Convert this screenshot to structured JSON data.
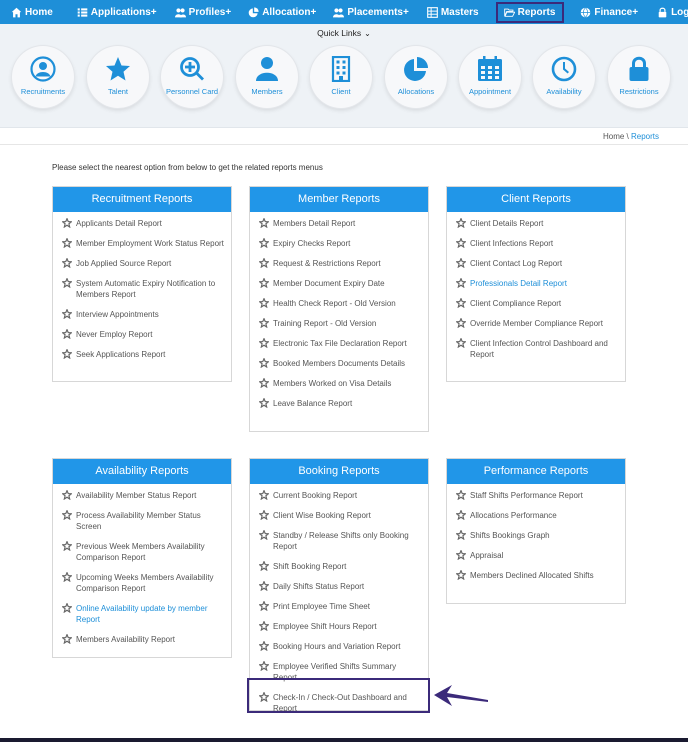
{
  "nav": {
    "home": "Home",
    "applications": "Applications+",
    "profiles": "Profiles+",
    "allocation": "Allocation+",
    "placements": "Placements+",
    "masters": "Masters",
    "reports": "Reports",
    "finance": "Finance+",
    "logins": "Logins+"
  },
  "quick_links": {
    "title": "Quick Links",
    "items": [
      {
        "label": "Recruitments",
        "icon": "user-circle-icon"
      },
      {
        "label": "Talent",
        "icon": "star-icon"
      },
      {
        "label": "Personnel Card",
        "icon": "search-plus-icon"
      },
      {
        "label": "Members",
        "icon": "user-icon"
      },
      {
        "label": "Client",
        "icon": "building-icon"
      },
      {
        "label": "Allocations",
        "icon": "pie-chart-icon"
      },
      {
        "label": "Appointment",
        "icon": "calendar-icon"
      },
      {
        "label": "Availability",
        "icon": "clock-icon"
      },
      {
        "label": "Restrictions",
        "icon": "lock-icon"
      }
    ]
  },
  "breadcrumb": {
    "home": "Home",
    "sep": " \\ ",
    "current": "Reports"
  },
  "intro": "Please select the nearest option from below to get the related reports menus",
  "panels": {
    "recruitment": {
      "title": "Recruitment Reports",
      "items": [
        "Applicants Detail Report",
        "Member Employment Work Status Report",
        "Job Applied Source Report",
        "System Automatic Expiry Notification to Members Report",
        "Interview Appointments",
        "Never Employ Report",
        "Seek Applications Report"
      ]
    },
    "member": {
      "title": "Member Reports",
      "items": [
        "Members Detail Report",
        "Expiry Checks Report",
        "Request & Restrictions Report",
        "Member Document Expiry Date",
        "Health Check Report - Old Version",
        "Training Report - Old Version",
        "Electronic Tax File Declaration Report",
        "Booked Members Documents Details",
        "Members Worked on Visa Details",
        "Leave Balance Report"
      ]
    },
    "client": {
      "title": "Client Reports",
      "items": [
        "Client Details Report",
        "Client Infections Report",
        "Client Contact Log Report",
        "Professionals Detail Report",
        "Client Compliance Report",
        "Override Member Compliance Report",
        "Client Infection Control Dashboard and Report"
      ]
    },
    "availability": {
      "title": "Availability Reports",
      "items": [
        "Availability Member Status Report",
        "Process Availability Member Status Screen",
        "Previous Week Members Availability Comparison Report",
        "Upcoming Weeks Members Availability Comparison Report",
        "Online Availability update by member Report",
        "Members Availability Report"
      ]
    },
    "booking": {
      "title": "Booking Reports",
      "items": [
        "Current Booking Report",
        "Client Wise Booking Report",
        "Standby / Release Shifts only Booking Report",
        "Shift Booking Report",
        "Daily Shifts Status Report",
        "Print Employee Time Sheet",
        "Employee Shift Hours Report",
        "Booking Hours and Variation Report",
        "Employee Verified Shifts Summary Report",
        "Check-In / Check-Out Dashboard and Report"
      ]
    },
    "performance": {
      "title": "Performance Reports",
      "items": [
        "Staff Shifts Performance Report",
        "Allocations Performance",
        "Shifts Bookings Graph",
        "Appraisal",
        "Members Declined Allocated Shifts"
      ]
    }
  },
  "colors": {
    "nav_bg": "#1e8fd8",
    "panel_header": "#2196e8",
    "link": "#1e8fd8",
    "highlight": "#3b2a7a"
  }
}
